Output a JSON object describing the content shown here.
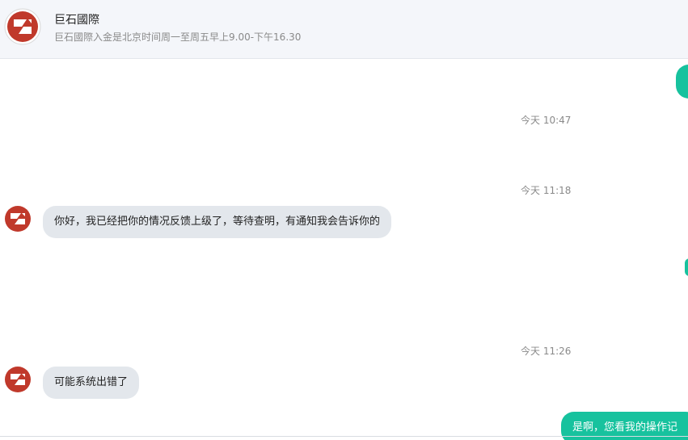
{
  "header": {
    "title": "巨石國際",
    "subtitle": "巨石國際入金是北京时间周一至周五早上9.00-下午16.30",
    "avatar_icon": "company-logo-icon"
  },
  "messages": [
    {
      "type": "time",
      "text": "今天 10:47"
    },
    {
      "type": "time",
      "text": "今天 11:18"
    },
    {
      "type": "incoming",
      "text": "你好，我已经把你的情况反馈上级了，等待查明，有通知我会告诉你的"
    },
    {
      "type": "time",
      "text": "今天 11:26"
    },
    {
      "type": "incoming",
      "text": "可能系统出错了"
    },
    {
      "type": "outgoing",
      "text": "是啊，您看我的操作记"
    }
  ],
  "colors": {
    "accent": "#17c29e",
    "incoming_bubble": "#e3e7ec",
    "header_bg": "#f4f6fa",
    "logo_red": "#c0392b"
  }
}
